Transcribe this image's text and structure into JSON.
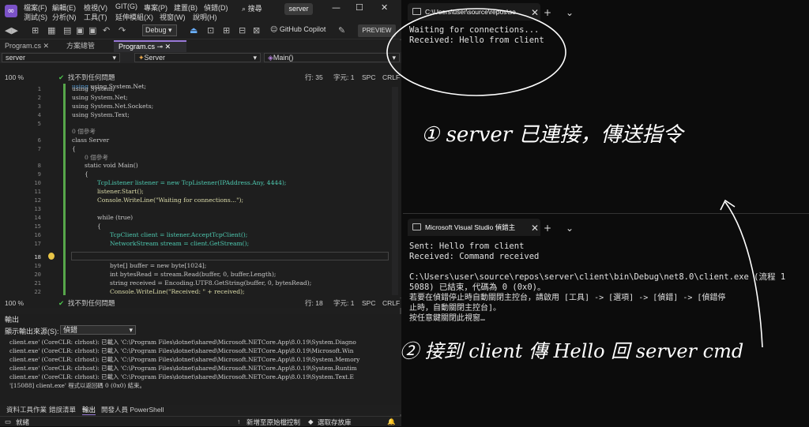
{
  "vs": {
    "menu_row1": [
      "檔案(F)",
      "編輯(E)",
      "檢視(V)",
      "GIT(G)",
      "專案(P)",
      "建置(B)",
      "偵錯(D)"
    ],
    "menu_row2": [
      "測試(S)",
      "分析(N)",
      "工具(T)",
      "延伸模組(X)",
      "視窗(W)",
      "說明(H)"
    ],
    "search_label": "搜尋",
    "project_badge": "server",
    "debug_config": "Debug",
    "copilot_label": "GitHub Copilot",
    "preview_label": "PREVIEW",
    "tabs": [
      "Program.cs",
      "方案總管",
      "Program.cs"
    ],
    "nav_project": "server",
    "nav_class": "Server",
    "nav_method": "Main()",
    "sticky_line": {
      "num": "2",
      "text": "using System.Net;"
    },
    "editor_status_top": {
      "zoom": "100 %",
      "issues": "找不到任何問題",
      "line": "行: 35",
      "col": "字元: 1",
      "spc": "SPC",
      "eol": "CRLF"
    },
    "editor_status_bottom": {
      "zoom": "100 %",
      "issues": "找不到任何問題",
      "line": "行: 18",
      "col": "字元: 1",
      "spc": "SPC",
      "eol": "CRLF"
    },
    "refs_label": "0 個參考",
    "code_lines": [
      {
        "num": "1",
        "text": "using System;"
      },
      {
        "num": "2",
        "text": "using System.Net;"
      },
      {
        "num": "3",
        "text": "using System.Net.Sockets;"
      },
      {
        "num": "4",
        "text": "using System.Text;"
      },
      {
        "num": "5",
        "text": ""
      },
      {
        "num": "6",
        "text": "class Server"
      },
      {
        "num": "7",
        "text": "{"
      },
      {
        "num": "8",
        "text": "static void Main()"
      },
      {
        "num": "9",
        "text": "{"
      },
      {
        "num": "10",
        "text": "TcpListener listener = new TcpListener(IPAddress.Any, 4444);"
      },
      {
        "num": "11",
        "text": "listener.Start();"
      },
      {
        "num": "12",
        "text": "Console.WriteLine(\"Waiting for connections...\");"
      },
      {
        "num": "13",
        "text": ""
      },
      {
        "num": "14",
        "text": "while (true)"
      },
      {
        "num": "15",
        "text": "{"
      },
      {
        "num": "16",
        "text": "TcpClient client = listener.AcceptTcpClient();"
      },
      {
        "num": "17",
        "text": "NetworkStream stream = client.GetStream();"
      },
      {
        "num": "18",
        "text": ""
      },
      {
        "num": "19",
        "text": "byte[] buffer = new byte[1024];"
      },
      {
        "num": "20",
        "text": "int bytesRead = stream.Read(buffer, 0, buffer.Length);"
      },
      {
        "num": "21",
        "text": "string received = Encoding.UTF8.GetString(buffer, 0, bytesRead);"
      },
      {
        "num": "22",
        "text": "Console.WriteLine(\"Received: \" + received);"
      }
    ],
    "output": {
      "title": "輸出",
      "source_label": "顯示輸出來源(S):",
      "source_value": "偵錯",
      "lines": [
        "client.exe' (CoreCLR: clrhost): 已載入 'C:\\Program Files\\dotnet\\shared\\Microsoft.NETCore.App\\8.0.19\\System.Diagno",
        "client.exe' (CoreCLR: clrhost): 已載入 'C:\\Program Files\\dotnet\\shared\\Microsoft.NETCore.App\\8.0.19\\Microsoft.Win",
        "client.exe' (CoreCLR: clrhost): 已載入 'C:\\Program Files\\dotnet\\shared\\Microsoft.NETCore.App\\8.0.19\\System.Memory",
        "client.exe' (CoreCLR: clrhost): 已載入 'C:\\Program Files\\dotnet\\shared\\Microsoft.NETCore.App\\8.0.19\\System.Runtim",
        "client.exe' (CoreCLR: clrhost): 已載入 'C:\\Program Files\\dotnet\\shared\\Microsoft.NETCore.App\\8.0.19\\System.Text.E",
        "'[15088] client.exe' 程式以返回碼 0 (0x0) 結束。"
      ]
    },
    "bottom_tabs": [
      "資料工具作業",
      "錯誤清單",
      "輸出",
      "開發人員 PowerShell"
    ],
    "status": {
      "ready": "就緒",
      "source_control": "新增至原始檔控制",
      "repo": "選取存放庫"
    }
  },
  "term1": {
    "tab_title": "C:\\Users\\user\\source\\repos\\se",
    "lines": [
      "Waiting for connections...",
      "Received: Hello from client"
    ]
  },
  "term2": {
    "tab_title": "Microsoft Visual Studio 偵錯主",
    "lines": [
      "Sent: Hello from client",
      "Received: Command received",
      "",
      "C:\\Users\\user\\source\\repos\\server\\client\\bin\\Debug\\net8.0\\client.exe (流程 1",
      "5088) 已結束，代碼為 0 (0x0)。",
      "若要在偵錯停止時自動關閉主控台，請啟用 [工具] -> [選項] -> [偵錯] -> [偵錯停",
      "止時，自動關閉主控台]。",
      "按任意鍵關閉此視窗…"
    ]
  },
  "annotations": {
    "note1": "① server 已連接，傳送指令",
    "note2": "② 接到 client 傳 Hello 回 server cmd"
  }
}
